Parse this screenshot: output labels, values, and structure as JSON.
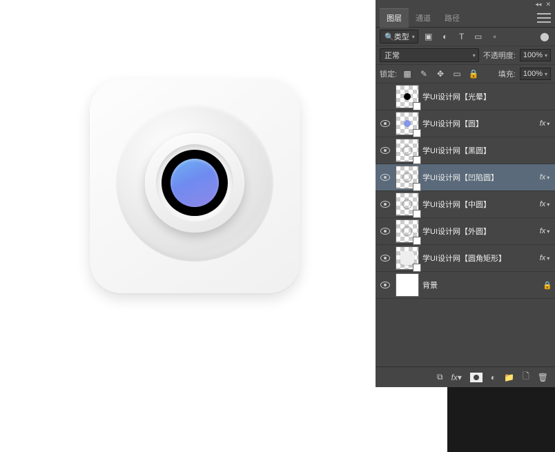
{
  "tabs": {
    "layers": "图层",
    "channels": "通道",
    "paths": "路径"
  },
  "filter": {
    "kind": "类型"
  },
  "blend": {
    "mode": "正常",
    "opacity_label": "不透明度:",
    "opacity_value": "100%"
  },
  "lock": {
    "label": "锁定:",
    "fill_label": "填充:",
    "fill_value": "100%"
  },
  "layers": [
    {
      "name": "学UI设计网【光晕】",
      "visible": false,
      "fx": false,
      "thumb": "chk-dot"
    },
    {
      "name": "学UI设计网【圆】",
      "visible": true,
      "fx": true,
      "thumb": "chk-blue"
    },
    {
      "name": "学UI设计网【黑圆】",
      "visible": true,
      "fx": false,
      "thumb": "chk-ring"
    },
    {
      "name": "学UI设计网【凹陷圆】",
      "visible": true,
      "fx": true,
      "thumb": "chk-ring",
      "selected": true
    },
    {
      "name": "学UI设计网【中圆】",
      "visible": true,
      "fx": true,
      "thumb": "chk-ring"
    },
    {
      "name": "学UI设计网【外圆】",
      "visible": true,
      "fx": true,
      "thumb": "chk-ring"
    },
    {
      "name": "学UI设计网【圆角矩形】",
      "visible": true,
      "fx": true,
      "thumb": "chk-card"
    },
    {
      "name": "背景",
      "visible": true,
      "fx": false,
      "locked": true,
      "thumb": "white"
    }
  ],
  "bottom_icons": {
    "link": "⧉",
    "fx": "fx",
    "adjust": "◐",
    "folder": "📁",
    "new": "🗋",
    "trash": "🗑"
  }
}
